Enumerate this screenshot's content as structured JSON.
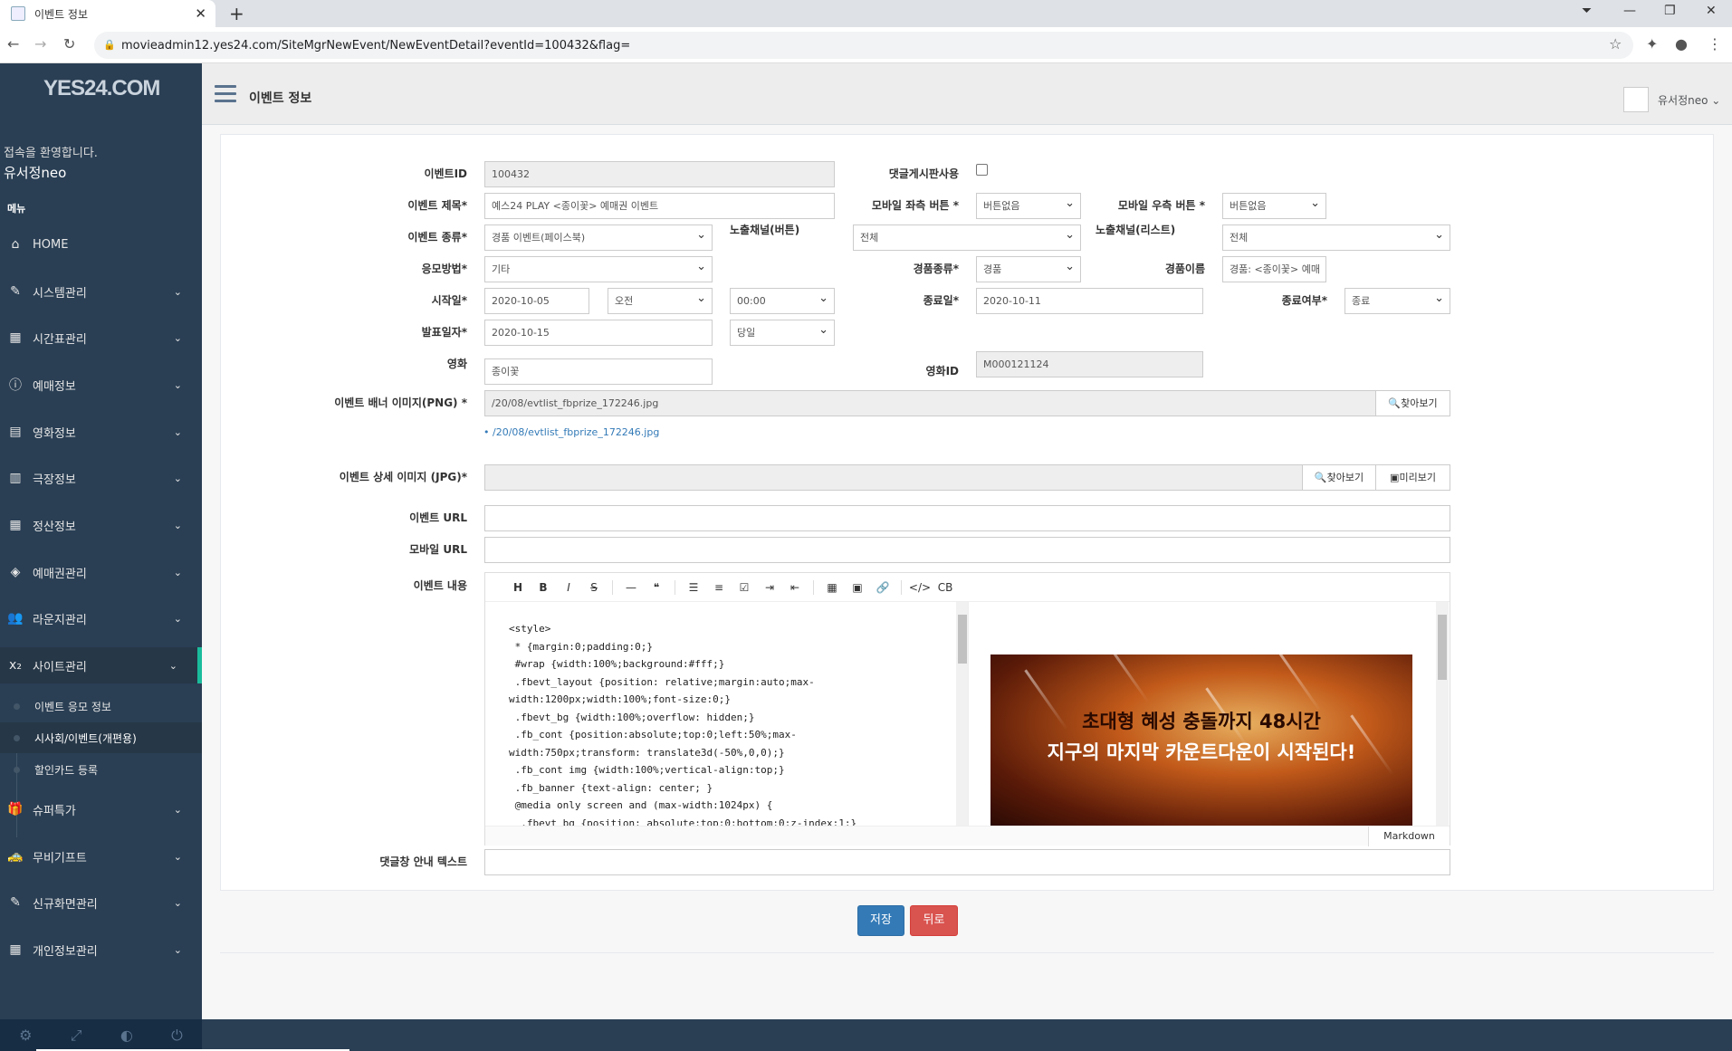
{
  "browser": {
    "tab_title": "이벤트 정보",
    "url": "movieadmin12.yes24.com/SiteMgrNewEvent/NewEventDetail?eventId=100432&flag="
  },
  "sidebar": {
    "logo": "YES24.COM",
    "welcome": "접속을 환영합니다.",
    "username": "유서정neo",
    "menu_header": "메뉴",
    "items": [
      {
        "label": "HOME",
        "icon": "home-icon"
      },
      {
        "label": "시스템관리",
        "icon": "edit-icon"
      },
      {
        "label": "시간표관리",
        "icon": "table-icon"
      },
      {
        "label": "예매정보",
        "icon": "info-icon"
      },
      {
        "label": "영화정보",
        "icon": "film-icon"
      },
      {
        "label": "극장정보",
        "icon": "building-icon"
      },
      {
        "label": "정산정보",
        "icon": "calculator-icon"
      },
      {
        "label": "예매권관리",
        "icon": "ticket-icon"
      },
      {
        "label": "라운지관리",
        "icon": "users-icon"
      },
      {
        "label": "사이트관리",
        "icon": "subscript-icon"
      },
      {
        "label": "슈퍼특가",
        "icon": "gift-icon"
      },
      {
        "label": "무비기프트",
        "icon": "car-icon"
      },
      {
        "label": "신규화면관리",
        "icon": "edit-icon"
      },
      {
        "label": "개인정보관리",
        "icon": "calendar-icon"
      }
    ],
    "subitems": [
      "이벤트 응모 정보",
      "시사회/이벤트(개편용)",
      "할인카드 등록"
    ]
  },
  "topnav": {
    "title": "이벤트 정보",
    "user": "유서정neo"
  },
  "form": {
    "event_id": {
      "label": "이벤트ID",
      "value": "100432"
    },
    "reply_board": {
      "label": "댓글게시판사용",
      "checked": false
    },
    "title": {
      "label": "이벤트 제목*",
      "value": "예스24 PLAY <종이꽃> 예매권 이벤트"
    },
    "mobile_left": {
      "label": "모바일 좌측 버튼 *",
      "value": "버튼없음"
    },
    "mobile_right": {
      "label": "모바일 우측 버튼 *",
      "value": "버튼없음"
    },
    "type": {
      "label": "이벤트 종류*",
      "value": "경품 이벤트(페이스북)"
    },
    "channel_button": {
      "label": "노출채널(버튼)",
      "value": "전체"
    },
    "channel_list": {
      "label": "노출채널(리스트)",
      "value": "전체"
    },
    "apply_method": {
      "label": "응모방법*",
      "value": "기타"
    },
    "prize_type": {
      "label": "경품종류*",
      "value": "경품"
    },
    "prize_name": {
      "label": "경품이름",
      "value": "경품: <종이꽃> 예매"
    },
    "start": {
      "label": "시작일*",
      "date": "2020-10-05",
      "ampm": "오전",
      "time": "00:00"
    },
    "end": {
      "label": "종료일*",
      "date": "2020-10-11"
    },
    "end_status": {
      "label": "종료여부*",
      "value": "종료"
    },
    "announce": {
      "label": "발표일자*",
      "date": "2020-10-15",
      "when": "당일"
    },
    "movie": {
      "label": "영화",
      "value": "종이꽃"
    },
    "movie_id": {
      "label": "영화ID",
      "value": "M000121124"
    },
    "banner": {
      "label": "이벤트 배너 이미지(PNG) *",
      "value": "/20/08/evtlist_fbprize_172246.jpg",
      "link": "/20/08/evtlist_fbprize_172246.jpg",
      "browse": "찾아보기"
    },
    "detail_image": {
      "label": "이벤트 상세 이미지 (JPG)*",
      "value": "",
      "browse": "찾아보기",
      "preview": "미리보기"
    },
    "event_url": {
      "label": "이벤트 URL",
      "value": ""
    },
    "mobile_url": {
      "label": "모바일 URL",
      "value": ""
    },
    "content": {
      "label": "이벤트 내용",
      "code": "<style>\n * {margin:0;padding:0;}\n #wrap {width:100%;background:#fff;}\n .fbevt_layout {position: relative;margin:auto;max-\nwidth:1200px;width:100%;font-size:0;}\n .fbevt_bg {width:100%;overflow: hidden;}\n .fb_cont {position:absolute;top:0;left:50%;max-\nwidth:750px;transform: translate3d(-50%,0,0);}\n .fb_cont img {width:100%;vertical-align:top;}\n .fb_banner {text-align: center; }\n @media only screen and (max-width:1024px) {\n  .fbevt_bg {position: absolute;top:0;bottom:0;z-index:1;}",
      "preview_line1": "초대형 혜성 충돌까지 48시간",
      "preview_line2": "지구의 마지막 카운트다운이 시작된다!",
      "mode": "Markdown"
    },
    "comment_text": {
      "label": "댓글창 안내 텍스트",
      "value": ""
    }
  },
  "buttons": {
    "save": "저장",
    "back": "뒤로"
  }
}
